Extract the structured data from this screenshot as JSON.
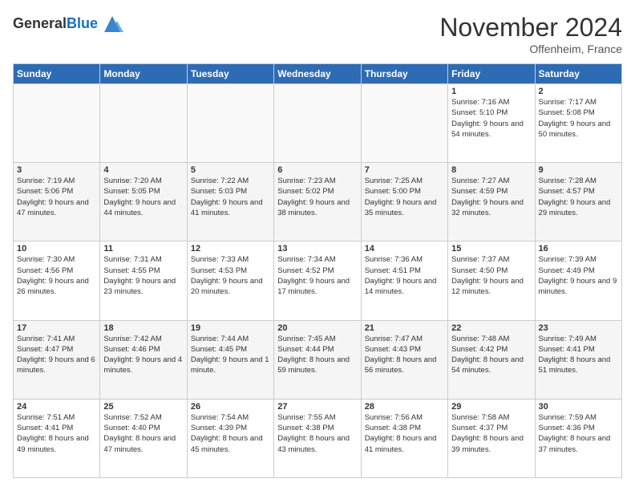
{
  "logo": {
    "general": "General",
    "blue": "Blue"
  },
  "header": {
    "title": "November 2024",
    "subtitle": "Offenheim, France"
  },
  "weekdays": [
    "Sunday",
    "Monday",
    "Tuesday",
    "Wednesday",
    "Thursday",
    "Friday",
    "Saturday"
  ],
  "weeks": [
    [
      {
        "day": "",
        "info": ""
      },
      {
        "day": "",
        "info": ""
      },
      {
        "day": "",
        "info": ""
      },
      {
        "day": "",
        "info": ""
      },
      {
        "day": "",
        "info": ""
      },
      {
        "day": "1",
        "info": "Sunrise: 7:16 AM\nSunset: 5:10 PM\nDaylight: 9 hours and 54 minutes."
      },
      {
        "day": "2",
        "info": "Sunrise: 7:17 AM\nSunset: 5:08 PM\nDaylight: 9 hours and 50 minutes."
      }
    ],
    [
      {
        "day": "3",
        "info": "Sunrise: 7:19 AM\nSunset: 5:06 PM\nDaylight: 9 hours and 47 minutes."
      },
      {
        "day": "4",
        "info": "Sunrise: 7:20 AM\nSunset: 5:05 PM\nDaylight: 9 hours and 44 minutes."
      },
      {
        "day": "5",
        "info": "Sunrise: 7:22 AM\nSunset: 5:03 PM\nDaylight: 9 hours and 41 minutes."
      },
      {
        "day": "6",
        "info": "Sunrise: 7:23 AM\nSunset: 5:02 PM\nDaylight: 9 hours and 38 minutes."
      },
      {
        "day": "7",
        "info": "Sunrise: 7:25 AM\nSunset: 5:00 PM\nDaylight: 9 hours and 35 minutes."
      },
      {
        "day": "8",
        "info": "Sunrise: 7:27 AM\nSunset: 4:59 PM\nDaylight: 9 hours and 32 minutes."
      },
      {
        "day": "9",
        "info": "Sunrise: 7:28 AM\nSunset: 4:57 PM\nDaylight: 9 hours and 29 minutes."
      }
    ],
    [
      {
        "day": "10",
        "info": "Sunrise: 7:30 AM\nSunset: 4:56 PM\nDaylight: 9 hours and 26 minutes."
      },
      {
        "day": "11",
        "info": "Sunrise: 7:31 AM\nSunset: 4:55 PM\nDaylight: 9 hours and 23 minutes."
      },
      {
        "day": "12",
        "info": "Sunrise: 7:33 AM\nSunset: 4:53 PM\nDaylight: 9 hours and 20 minutes."
      },
      {
        "day": "13",
        "info": "Sunrise: 7:34 AM\nSunset: 4:52 PM\nDaylight: 9 hours and 17 minutes."
      },
      {
        "day": "14",
        "info": "Sunrise: 7:36 AM\nSunset: 4:51 PM\nDaylight: 9 hours and 14 minutes."
      },
      {
        "day": "15",
        "info": "Sunrise: 7:37 AM\nSunset: 4:50 PM\nDaylight: 9 hours and 12 minutes."
      },
      {
        "day": "16",
        "info": "Sunrise: 7:39 AM\nSunset: 4:49 PM\nDaylight: 9 hours and 9 minutes."
      }
    ],
    [
      {
        "day": "17",
        "info": "Sunrise: 7:41 AM\nSunset: 4:47 PM\nDaylight: 9 hours and 6 minutes."
      },
      {
        "day": "18",
        "info": "Sunrise: 7:42 AM\nSunset: 4:46 PM\nDaylight: 9 hours and 4 minutes."
      },
      {
        "day": "19",
        "info": "Sunrise: 7:44 AM\nSunset: 4:45 PM\nDaylight: 9 hours and 1 minute."
      },
      {
        "day": "20",
        "info": "Sunrise: 7:45 AM\nSunset: 4:44 PM\nDaylight: 8 hours and 59 minutes."
      },
      {
        "day": "21",
        "info": "Sunrise: 7:47 AM\nSunset: 4:43 PM\nDaylight: 8 hours and 56 minutes."
      },
      {
        "day": "22",
        "info": "Sunrise: 7:48 AM\nSunset: 4:42 PM\nDaylight: 8 hours and 54 minutes."
      },
      {
        "day": "23",
        "info": "Sunrise: 7:49 AM\nSunset: 4:41 PM\nDaylight: 8 hours and 51 minutes."
      }
    ],
    [
      {
        "day": "24",
        "info": "Sunrise: 7:51 AM\nSunset: 4:41 PM\nDaylight: 8 hours and 49 minutes."
      },
      {
        "day": "25",
        "info": "Sunrise: 7:52 AM\nSunset: 4:40 PM\nDaylight: 8 hours and 47 minutes."
      },
      {
        "day": "26",
        "info": "Sunrise: 7:54 AM\nSunset: 4:39 PM\nDaylight: 8 hours and 45 minutes."
      },
      {
        "day": "27",
        "info": "Sunrise: 7:55 AM\nSunset: 4:38 PM\nDaylight: 8 hours and 43 minutes."
      },
      {
        "day": "28",
        "info": "Sunrise: 7:56 AM\nSunset: 4:38 PM\nDaylight: 8 hours and 41 minutes."
      },
      {
        "day": "29",
        "info": "Sunrise: 7:58 AM\nSunset: 4:37 PM\nDaylight: 8 hours and 39 minutes."
      },
      {
        "day": "30",
        "info": "Sunrise: 7:59 AM\nSunset: 4:36 PM\nDaylight: 8 hours and 37 minutes."
      }
    ]
  ]
}
